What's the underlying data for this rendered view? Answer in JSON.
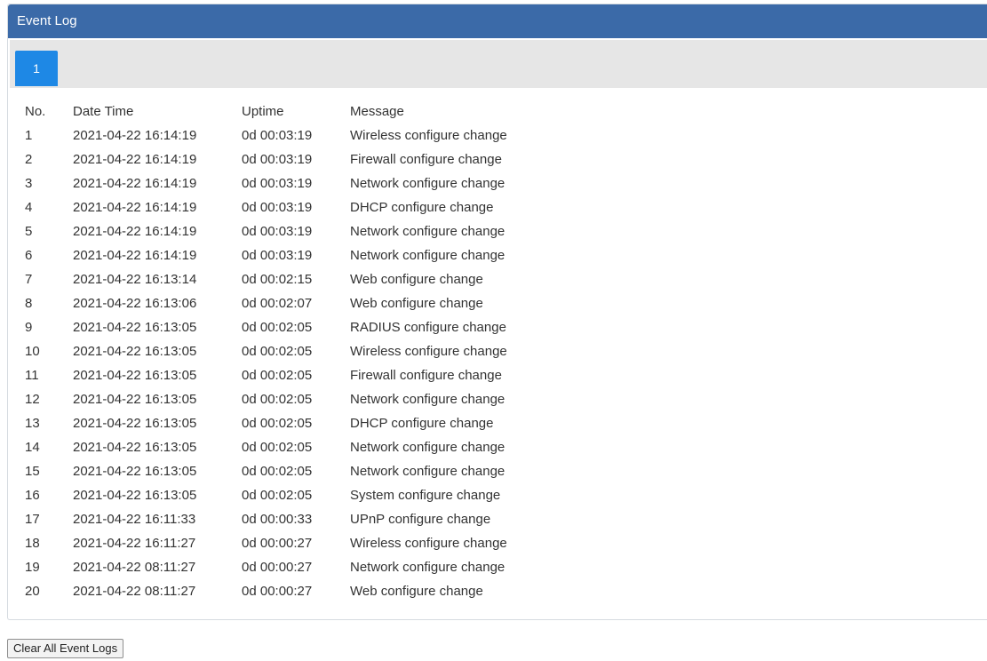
{
  "panel": {
    "title": "Event Log"
  },
  "pagination": {
    "pages": [
      "1"
    ],
    "current": "1"
  },
  "table": {
    "columns": [
      "No.",
      "Date Time",
      "Uptime",
      "Message"
    ],
    "rows": [
      [
        "1",
        "2021-04-22 16:14:19",
        "0d 00:03:19",
        "Wireless configure change"
      ],
      [
        "2",
        "2021-04-22 16:14:19",
        "0d 00:03:19",
        "Firewall configure change"
      ],
      [
        "3",
        "2021-04-22 16:14:19",
        "0d 00:03:19",
        "Network configure change"
      ],
      [
        "4",
        "2021-04-22 16:14:19",
        "0d 00:03:19",
        "DHCP configure change"
      ],
      [
        "5",
        "2021-04-22 16:14:19",
        "0d 00:03:19",
        "Network configure change"
      ],
      [
        "6",
        "2021-04-22 16:14:19",
        "0d 00:03:19",
        "Network configure change"
      ],
      [
        "7",
        "2021-04-22 16:13:14",
        "0d 00:02:15",
        "Web configure change"
      ],
      [
        "8",
        "2021-04-22 16:13:06",
        "0d 00:02:07",
        "Web configure change"
      ],
      [
        "9",
        "2021-04-22 16:13:05",
        "0d 00:02:05",
        "RADIUS configure change"
      ],
      [
        "10",
        "2021-04-22 16:13:05",
        "0d 00:02:05",
        "Wireless configure change"
      ],
      [
        "11",
        "2021-04-22 16:13:05",
        "0d 00:02:05",
        "Firewall configure change"
      ],
      [
        "12",
        "2021-04-22 16:13:05",
        "0d 00:02:05",
        "Network configure change"
      ],
      [
        "13",
        "2021-04-22 16:13:05",
        "0d 00:02:05",
        "DHCP configure change"
      ],
      [
        "14",
        "2021-04-22 16:13:05",
        "0d 00:02:05",
        "Network configure change"
      ],
      [
        "15",
        "2021-04-22 16:13:05",
        "0d 00:02:05",
        "Network configure change"
      ],
      [
        "16",
        "2021-04-22 16:13:05",
        "0d 00:02:05",
        "System configure change"
      ],
      [
        "17",
        "2021-04-22 16:11:33",
        "0d 00:00:33",
        "UPnP configure change"
      ],
      [
        "18",
        "2021-04-22 16:11:27",
        "0d 00:00:27",
        "Wireless configure change"
      ],
      [
        "19",
        "2021-04-22 08:11:27",
        "0d 00:00:27",
        "Network configure change"
      ],
      [
        "20",
        "2021-04-22 08:11:27",
        "0d 00:00:27",
        "Web configure change"
      ]
    ]
  },
  "actions": {
    "clear_label": "Clear All Event Logs"
  },
  "colors": {
    "header_bg": "#3b6aa8",
    "active_tab": "#1e88e5",
    "tab_bar_bg": "#e6e6e6",
    "text": "#333333"
  }
}
